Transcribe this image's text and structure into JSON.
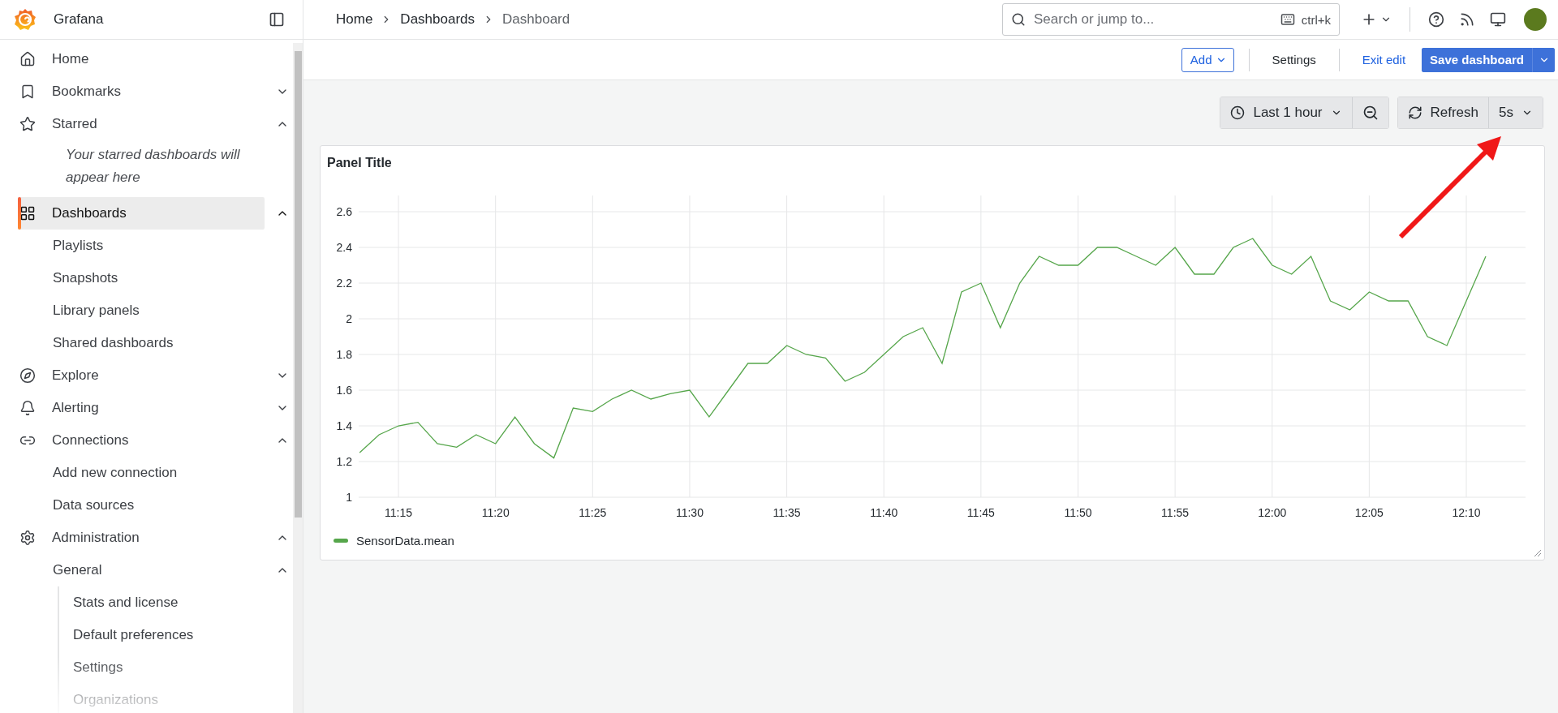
{
  "sidebar": {
    "brand": "Grafana",
    "items": [
      {
        "label": "Home",
        "selected": false
      },
      {
        "label": "Bookmarks",
        "expanded": false,
        "selected": false
      },
      {
        "label": "Starred",
        "expanded": true,
        "selected": false,
        "note": "Your starred dashboards will appear here"
      },
      {
        "label": "Dashboards",
        "expanded": true,
        "selected": true,
        "children": [
          {
            "label": "Playlists",
            "selected": false
          },
          {
            "label": "Snapshots",
            "selected": false
          },
          {
            "label": "Library panels",
            "selected": false
          },
          {
            "label": "Shared dashboards",
            "selected": false
          }
        ]
      },
      {
        "label": "Explore",
        "expanded": false,
        "selected": false
      },
      {
        "label": "Alerting",
        "expanded": false,
        "selected": false
      },
      {
        "label": "Connections",
        "expanded": true,
        "selected": false,
        "children": [
          {
            "label": "Add new connection",
            "selected": false
          },
          {
            "label": "Data sources",
            "selected": false
          }
        ]
      },
      {
        "label": "Administration",
        "expanded": true,
        "selected": false,
        "children": [
          {
            "label": "General",
            "expanded": true,
            "selected": false,
            "children": [
              {
                "label": "Stats and license",
                "selected": false
              },
              {
                "label": "Default preferences",
                "selected": false
              },
              {
                "label": "Settings",
                "selected": false
              },
              {
                "label": "Organizations",
                "selected": false
              }
            ]
          }
        ]
      }
    ]
  },
  "breadcrumbs": [
    {
      "label": "Home",
      "selected": false
    },
    {
      "label": "Dashboards",
      "selected": false
    },
    {
      "label": "Dashboard",
      "selected": true
    }
  ],
  "search": {
    "placeholder": "Search or jump to...",
    "shortcut": "ctrl+k"
  },
  "actions": {
    "add": "Add",
    "settings": "Settings",
    "exit": "Exit edit",
    "save": "Save dashboard"
  },
  "time_picker": {
    "range": "Last 1 hour"
  },
  "refresh": {
    "label": "Refresh",
    "interval": "5s"
  },
  "panel": {
    "title": "Panel Title",
    "chart_data": {
      "type": "line",
      "categories": [
        null,
        null,
        "11:15",
        null,
        null,
        null,
        null,
        "11:20",
        null,
        null,
        null,
        null,
        "11:25",
        null,
        null,
        null,
        null,
        "11:30",
        null,
        null,
        null,
        null,
        "11:35",
        null,
        null,
        null,
        null,
        "11:40",
        null,
        null,
        null,
        null,
        "11:45",
        null,
        null,
        null,
        null,
        "11:50",
        null,
        null,
        null,
        null,
        "11:55",
        null,
        null,
        null,
        null,
        "12:00",
        null,
        null,
        null,
        null,
        "12:05",
        null,
        null,
        null,
        null,
        "12:10",
        null
      ],
      "series": [
        {
          "name": "SensorData.mean",
          "color": "#56a64b",
          "values": [
            1.25,
            1.35,
            1.4,
            1.42,
            1.3,
            1.28,
            1.35,
            1.3,
            1.45,
            1.3,
            1.22,
            1.5,
            1.48,
            1.55,
            1.6,
            1.55,
            1.58,
            1.6,
            1.45,
            1.6,
            1.75,
            1.75,
            1.85,
            1.8,
            1.78,
            1.65,
            1.7,
            1.8,
            1.9,
            1.95,
            1.75,
            2.15,
            2.2,
            1.95,
            2.2,
            2.35,
            2.3,
            2.3,
            2.4,
            2.4,
            2.35,
            2.3,
            2.4,
            2.25,
            2.25,
            2.4,
            2.45,
            2.3,
            2.25,
            2.35,
            2.1,
            2.05,
            2.15,
            2.1,
            2.1,
            1.9,
            1.85,
            2.1,
            2.35
          ]
        }
      ],
      "ylim": [
        1,
        2.6
      ],
      "grid": true,
      "yticks": [
        1,
        1.2,
        1.4,
        1.6,
        1.8,
        2,
        2.2,
        2.4,
        2.6
      ]
    }
  }
}
